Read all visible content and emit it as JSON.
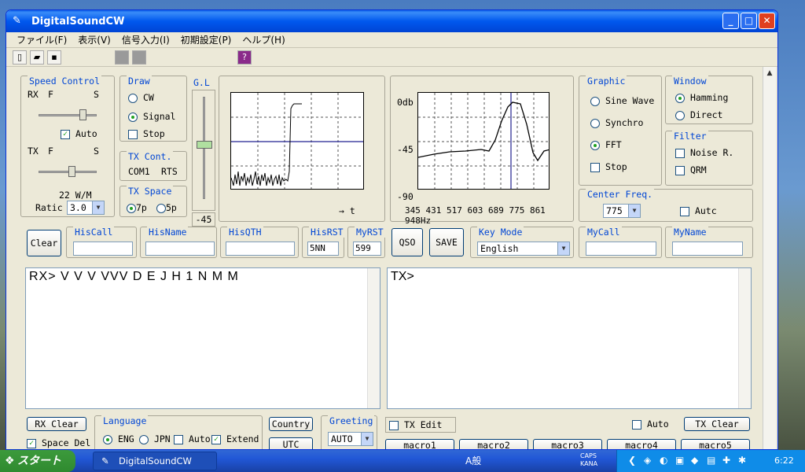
{
  "window": {
    "title": "DigitalSoundCW"
  },
  "menu": [
    "ファイル(F)",
    "表示(V)",
    "信号入力(I)",
    "初期設定(P)",
    "ヘルプ(H)"
  ],
  "speed_control": {
    "label": "Speed Control",
    "rx": "RX",
    "tx": "TX",
    "f": "F",
    "s": "S",
    "auto": "Auto",
    "wpm": "22 W/M",
    "ratio_label": "Ratic",
    "ratio_value": "3.0"
  },
  "draw": {
    "label": "Draw",
    "cw": "CW",
    "signal": "Signal",
    "stop": "Stop"
  },
  "tx_cont": {
    "label": "TX Cont.",
    "com": "COM1",
    "rts": "RTS"
  },
  "tx_space": {
    "label": "TX Space",
    "p7": "7p",
    "p5": "5p"
  },
  "gl": {
    "label": "G.L",
    "value": "-45"
  },
  "scope": {
    "axis_label": "→ t"
  },
  "spectrum": {
    "y_labels": [
      "0db",
      "-45",
      "-90"
    ],
    "x_labels": "345 431 517 603 689 775 861 948Hz"
  },
  "graphic": {
    "label": "Graphic",
    "sine": "Sine Wave",
    "synchro": "Synchro",
    "fft": "FFT",
    "stop": "Stop"
  },
  "window_fn": {
    "label": "Window",
    "hamming": "Hamming",
    "direct": "Direct"
  },
  "filter": {
    "label": "Filter",
    "noise": "Noise R.",
    "qrm": "QRM"
  },
  "center_freq": {
    "label": "Center Freq.",
    "value": "775",
    "auto": "Autc"
  },
  "fields": {
    "clear": "Clear",
    "his_call": "HisCall",
    "his_name": "HisName",
    "his_qth": "HisQTH",
    "his_rst": "HisRST",
    "his_rst_value": "5NN",
    "my_rst": "MyRST",
    "my_rst_value": "599",
    "qso": "QSO",
    "save": "SAVE",
    "key_mode": "Key Mode",
    "key_mode_value": "English",
    "my_call": "MyCall",
    "my_name": "MyName"
  },
  "rx_text": "RX> V V V VVV D E J H 1 N M M",
  "tx_text": "TX>",
  "bottom": {
    "rx_clear": "RX Clear",
    "space_del": "Space Del",
    "language": "Language",
    "eng": "ENG",
    "jpn": "JPN",
    "auto": "Auto",
    "extend": "Extend",
    "country": "Country",
    "utc": "UTC",
    "greeting": "Greeting",
    "greeting_value": "AUTO",
    "tx_edit": "TX Edit",
    "tx_auto": "Auto",
    "tx_clear": "TX Clear",
    "macros": [
      "macro1",
      "macro2",
      "macro3",
      "macro4",
      "macro5"
    ]
  },
  "taskbar": {
    "start": "スタート",
    "task": "DigitalSoundCW",
    "tray_caps": "CAPS",
    "tray_kana": "KANA",
    "ime": "A般",
    "clock": "6:22"
  }
}
